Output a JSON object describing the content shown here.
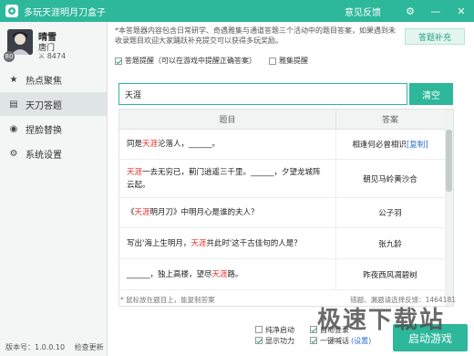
{
  "titlebar": {
    "title": "多玩天涯明月刀盒子",
    "feedback": "意见反馈",
    "settings_glyph": "⚙",
    "minimize_glyph": "—",
    "close_glyph": "✕"
  },
  "user": {
    "name": "晴雪",
    "sect": "唐门",
    "score": "8474",
    "level": "80"
  },
  "sidebar": {
    "items": [
      {
        "icon": "star-icon",
        "glyph": "★",
        "label": "热点聚焦",
        "active": false
      },
      {
        "icon": "answer-icon",
        "glyph": "▤",
        "label": "天刀答题",
        "active": true
      },
      {
        "icon": "face-swap-icon",
        "glyph": "◉",
        "label": "捏脸替换",
        "active": false
      },
      {
        "icon": "gear-icon",
        "glyph": "⚙",
        "label": "系统设置",
        "active": false
      }
    ],
    "version": "版本号：1.0.0.10",
    "check_update": "检查更新"
  },
  "notice": "*本答题器内容包含日常研学、奇遇雅集与通道答题三个活动中的题目答案，如果遇到未收录题目欢迎大家踊跃补充提交可以获得多玩奖励。",
  "supply_button": "答题补充",
  "options": {
    "answer_hint": "答题提醒（可以在游戏中提醒正确答案）",
    "yaji_hint": "雅集提醒"
  },
  "search": {
    "value": "天涯",
    "clear_button": "清空"
  },
  "table": {
    "col_question": "题目",
    "col_answer": "答案",
    "rows": [
      {
        "q_pre": "同是",
        "q_hl": "天涯",
        "q_post": "沦落人，______。",
        "answer": "相逢何必曾相识",
        "copy": "[复制]"
      },
      {
        "q_pre": "",
        "q_hl": "天涯",
        "q_post": "一去无穷已，蓟门逍遥三千里。______，夕望龙城阵云起。",
        "answer": "朝见马岭黄沙合",
        "copy": ""
      },
      {
        "q_pre": "《",
        "q_hl": "天涯",
        "q_post": "明月刀》中明月心是谁的夫人？",
        "answer": "公子羽",
        "copy": ""
      },
      {
        "q_pre": "写出'海上生明月，",
        "q_hl": "天涯",
        "q_post": "共此时'这千古佳句的人是？",
        "answer": "张九龄",
        "copy": ""
      },
      {
        "q_pre": "______，独上高楼，望尽",
        "q_hl": "天涯",
        "q_post": "路。",
        "answer": "昨夜西风凋碧树",
        "copy": ""
      }
    ],
    "footer_left": "* 鼠标放在题目上，能复制答案",
    "footer_right": "错题、漏题请选择反馈：1464181"
  },
  "bottom": {
    "pure_start": "纯净启动",
    "show_power": "显示功力",
    "auto_login": "自动登录",
    "one_click": "一键喊话",
    "settings_link": "(设置)",
    "start_button": "启动游戏"
  },
  "watermark": "极速下载站"
}
